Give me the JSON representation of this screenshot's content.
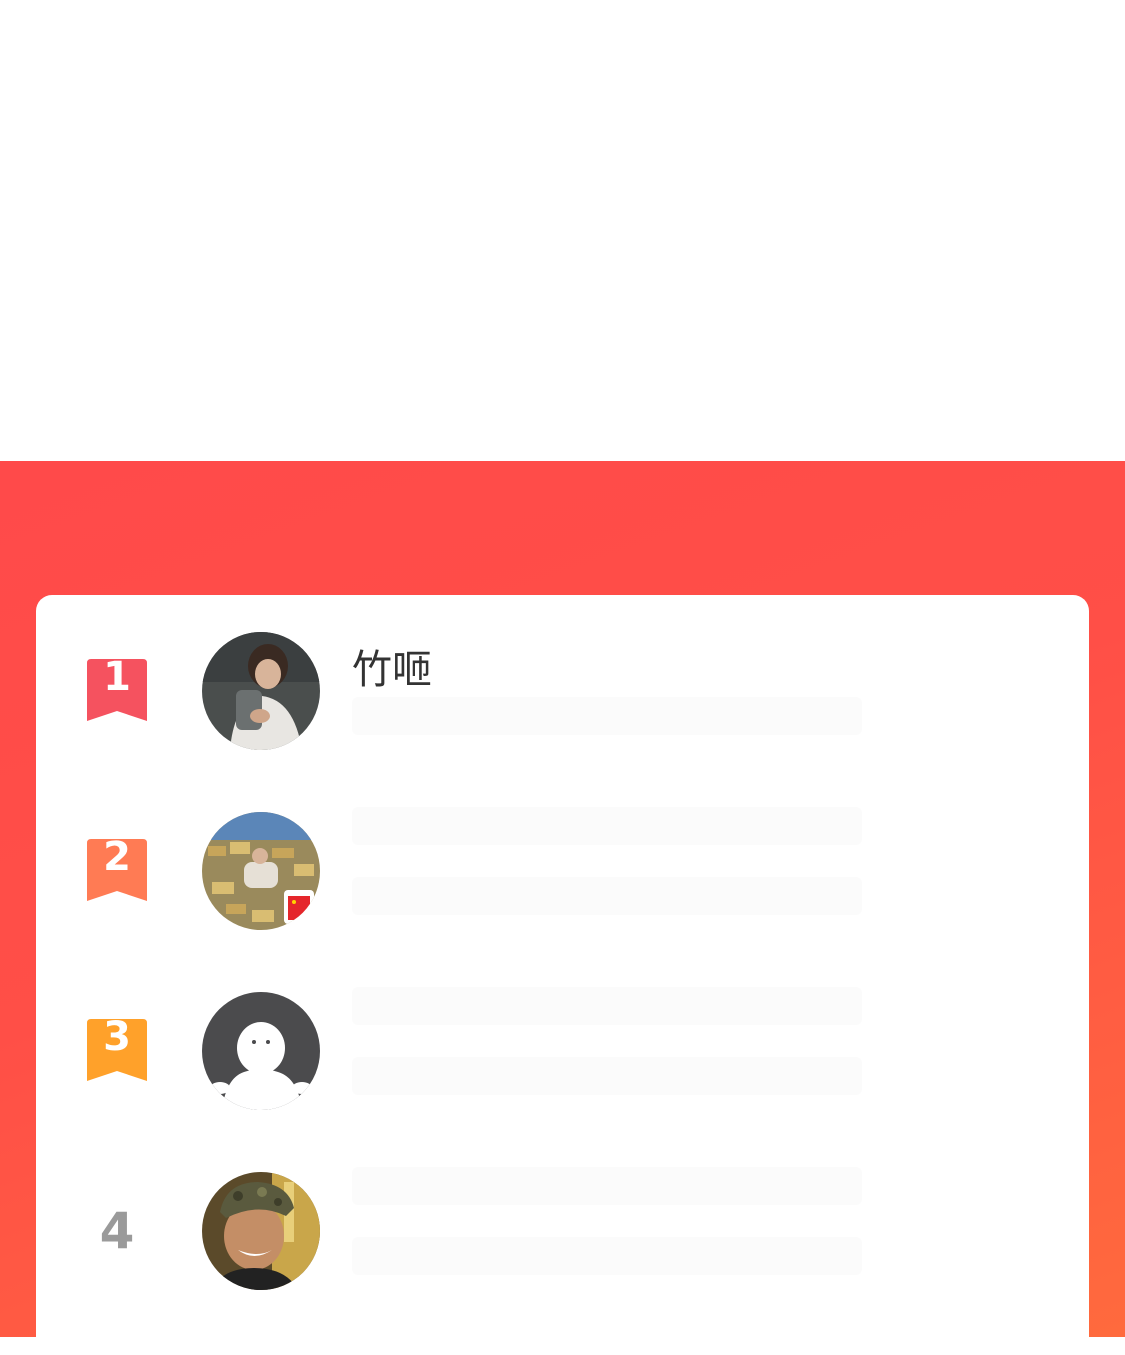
{
  "colors": {
    "panel_red": "#ff4a4a",
    "panel_orange": "#ff6a3d",
    "rank1": "#f5525f",
    "rank2": "#ff7b54",
    "rank3": "#ffa12a",
    "rank_plain": "#9a9a9a",
    "card": "#ffffff"
  },
  "leaderboard": {
    "rows": [
      {
        "rank": "1",
        "name": "竹咂",
        "avatar": "photo-avatar"
      },
      {
        "rank": "2",
        "name": "",
        "avatar": "photo-avatar"
      },
      {
        "rank": "3",
        "name": "",
        "avatar": "default-avatar"
      },
      {
        "rank": "4",
        "name": "",
        "avatar": "photo-avatar"
      }
    ]
  }
}
